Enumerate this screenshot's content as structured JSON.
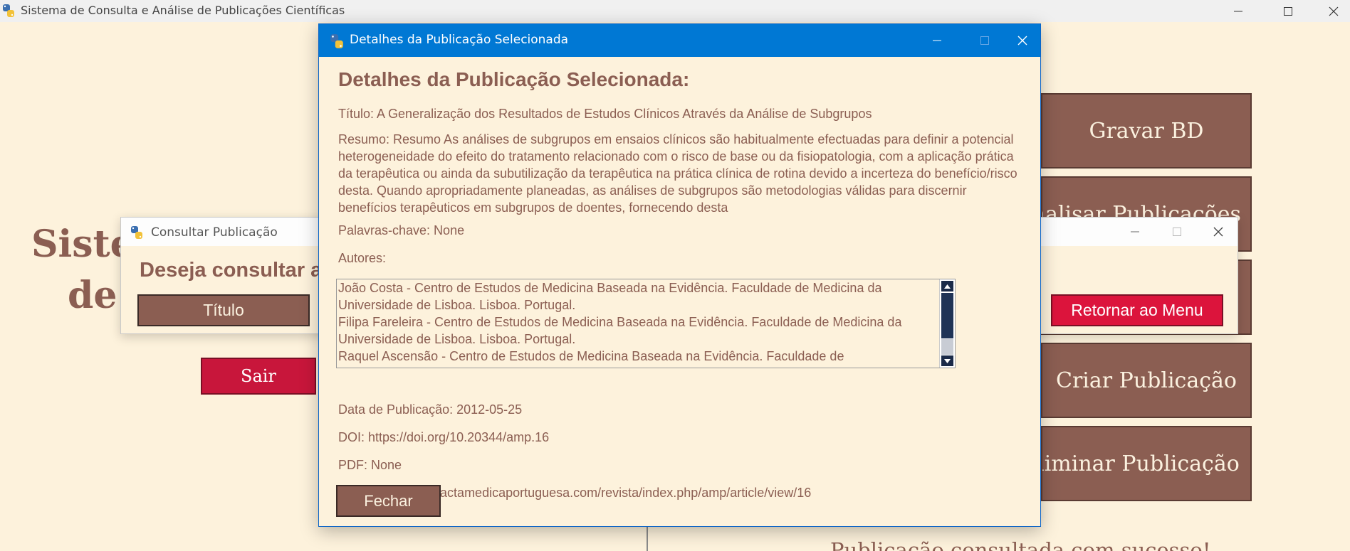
{
  "main_window": {
    "title": "Sistema de Consulta e Análise de Publicações Científicas",
    "heading_line1": "Siste",
    "heading_line2": "de",
    "menu_buttons": [
      {
        "label": "Gravar BD"
      },
      {
        "label": "Analisar Publicações"
      },
      {
        "label": ""
      },
      {
        "label": "Criar Publicação"
      },
      {
        "label": "Eliminar Publicação"
      }
    ],
    "exit_label": "Sair",
    "status_message": "Publicação consultada com sucesso!"
  },
  "consult_dialog": {
    "title": "Consultar Publicação",
    "question": "Deseja consultar a",
    "title_button": "Título",
    "return_button": "Retornar ao Menu"
  },
  "details_dialog": {
    "window_title": "Detalhes da Publicação Selecionada",
    "heading": "Detalhes da Publicação Selecionada:",
    "title_line": "Título: A Generalização dos Resultados de Estudos Clínicos Através da Análise de Subgrupos",
    "abstract": "Resumo: Resumo As análises de subgrupos em ensaios clínicos são habitualmente efectuadas para definir a potencial heterogeneidade do efeito do tratamento relacionado com o risco de base ou da fisiopatologia, com a aplicação prática da terapêutica ou ainda da subutilização da terapêutica na prática clínica de rotina devido a incerteza do benefício/risco desta. Quando apropriadamente planeadas, as análises de subgrupos são metodologias válidas para discernir benefícios terapêuticos em subgrupos de doentes, fornecendo desta",
    "keywords": "Palavras-chave: None",
    "authors_label": "Autores:",
    "authors": [
      "João Costa - Centro de Estudos de Medicina Baseada na Evidência. Faculdade de Medicina da Universidade de Lisboa. Lisboa. Portugal.",
      "Filipa Fareleira - Centro de Estudos de Medicina Baseada na Evidência. Faculdade de Medicina da Universidade de Lisboa. Lisboa. Portugal.",
      "Raquel Ascensão - Centro de Estudos de Medicina Baseada na Evidência. Faculdade de"
    ],
    "publication_date": "Data de Publicação: 2012-05-25",
    "doi": "DOI: https://doi.org/10.20344/amp.16",
    "pdf": "PDF: None",
    "url": "URL: https://www.actamedicaportuguesa.com/revista/index.php/amp/article/view/16",
    "close_button": "Fechar"
  },
  "colors": {
    "background": "#fdf2dc",
    "accent_brown": "#8b5e52",
    "danger_red": "#dc143c",
    "titlebar_blue": "#0078d4"
  },
  "icons": [
    "python-app-icon",
    "minimize-icon",
    "maximize-icon",
    "close-icon",
    "scroll-up-arrow-icon",
    "scroll-down-arrow-icon"
  ]
}
